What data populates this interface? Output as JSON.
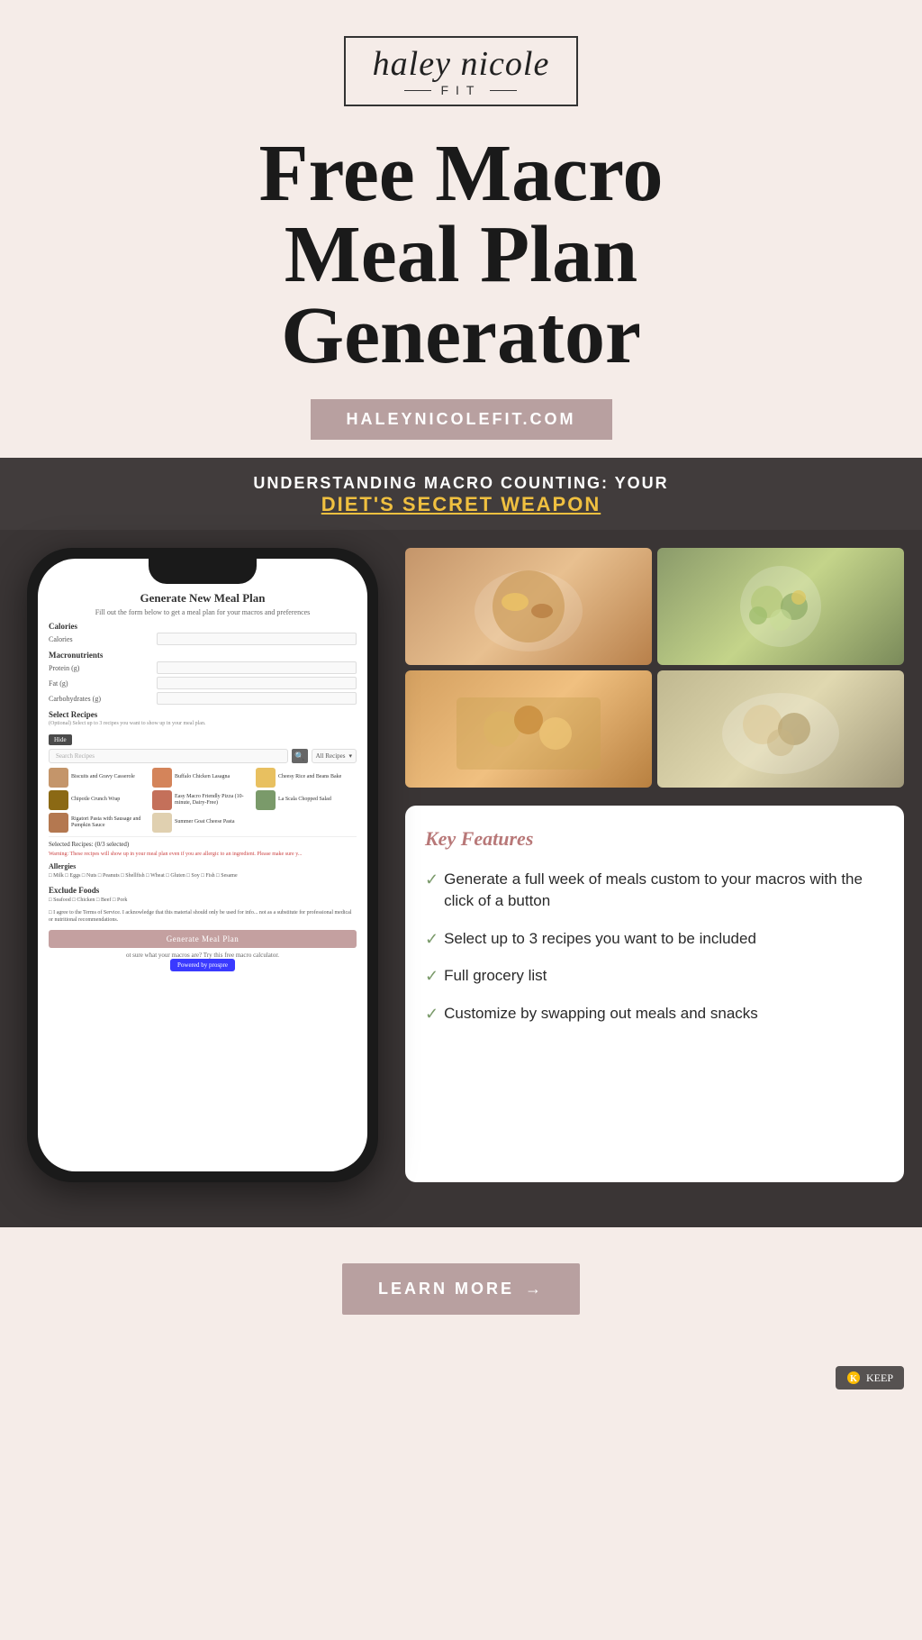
{
  "brand": {
    "logo_script": "haley nicole",
    "logo_fit": "FIT",
    "website": "HALEYNICOLEFIT.COM"
  },
  "hero": {
    "title_line1": "Free Macro",
    "title_line2": "Meal Plan",
    "title_line3": "Generator"
  },
  "banner": {
    "line1": "UNDERSTANDING MACRO COUNTING: YOUR",
    "line2": "DIET'S SECRET WEAPON"
  },
  "phone": {
    "page_title": "Generate New Meal Plan",
    "subtitle": "Fill out the form below to get a meal plan for your macros and preferences",
    "calories_label": "Calories",
    "calories_field_label": "Calories",
    "macros_label": "Macronutrients",
    "protein_label": "Protein (g)",
    "fat_label": "Fat (g)",
    "carbs_label": "Carbohydrates (g)",
    "recipes_label": "Select Recipes",
    "recipes_optional": "(Optional) Select up to 3 recipes you want to show up in your meal plan.",
    "hide_btn": "Hide",
    "search_placeholder": "Search Recipes",
    "dropdown_label": "All Recipes",
    "recipes": [
      {
        "name": "Biscuits and Gravy Casserole",
        "color": "rt-biscuits"
      },
      {
        "name": "Buffalo Chicken Lasagna",
        "color": "rt-buffalo"
      },
      {
        "name": "Cheesy Rice and Beans Bake",
        "color": "rt-cheesy"
      },
      {
        "name": "Chipotle Crunch Wrap",
        "color": "rt-chipotle"
      },
      {
        "name": "Easy Macro Friendly Pizza (10-minute, Dairy-Free)",
        "color": "rt-pizza"
      },
      {
        "name": "La Scala Chopped Salad",
        "color": "rt-scala"
      },
      {
        "name": "Rigatori Pasta with Sausage and Pumpkin Sauce",
        "color": "rt-rigatori"
      },
      {
        "name": "Summer Goat Cheese Pasta",
        "color": "rt-goat"
      }
    ],
    "selected_label": "Selected Recipes: (0/3 selected)",
    "warning": "Warning: These recipes will show up in your meal plan even if you are allergic to an ingredient. Please make sure y...",
    "allergies_label": "Allergies",
    "allergies": "□ Milk □ Eggs □ Nuts □ Peanuts □ Shellfish □ Wheat □ Gluten □ Soy □ Fish □ Sesame",
    "exclude_label": "Exclude Foods",
    "exclude_items": "□ Seafood □ Chicken □ Beef □ Pork",
    "tos": "□ I agree to the Terms of Service. I acknowledge that this material should only be used for info... not as a substitute for professional medical or nutritional recommendations.",
    "generate_btn": "Generate Meal Plan",
    "macro_calc_text": "ot sure what your macros are? Try this free macro calculator.",
    "powered_by": "Powered by prospre"
  },
  "key_features": {
    "title": "Key Features",
    "items": [
      {
        "check": "✓",
        "text": "Generate a full week of meals custom to your macros with the click of a button"
      },
      {
        "check": "✓",
        "text": "Select up to 3 recipes you want to be included"
      },
      {
        "check": "✓",
        "text": "Full grocery list"
      },
      {
        "check": "✓",
        "text": "Customize by swapping out meals and snacks"
      }
    ]
  },
  "cta": {
    "learn_more": "LEARN MORE",
    "arrow": "→"
  },
  "keep": {
    "label": "KEEP"
  }
}
